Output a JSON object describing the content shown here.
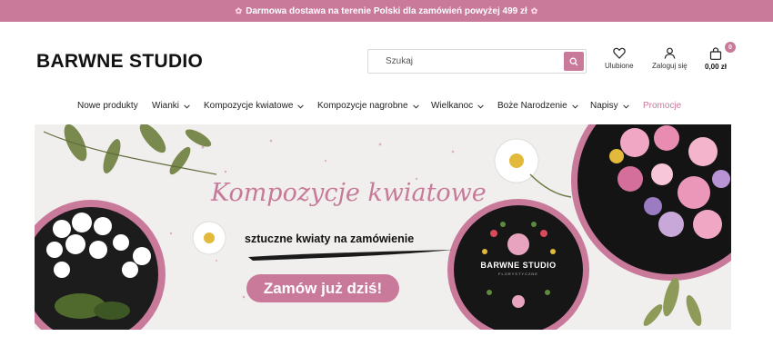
{
  "colors": {
    "accent": "#c9799a"
  },
  "promo": {
    "text": "Darmowa dostawa na terenie Polski dla zamówień powyżej 499 zł",
    "icon": "flower-icon"
  },
  "header": {
    "logo": "BARWNE STUDIO",
    "search": {
      "placeholder": "Szukaj",
      "icon": "search-icon"
    },
    "favorites": {
      "label": "Ulubione",
      "icon": "heart-icon"
    },
    "login": {
      "label": "Zaloguj się",
      "icon": "user-icon"
    },
    "cart": {
      "count": "0",
      "total": "0,00 zł",
      "icon": "bag-icon"
    }
  },
  "nav": {
    "items": [
      {
        "label": "Nowe produkty",
        "dropdown": false
      },
      {
        "label": "Wianki",
        "dropdown": true
      },
      {
        "label": "Kompozycje kwiatowe",
        "dropdown": true
      },
      {
        "label": "Kompozycje nagrobne",
        "dropdown": true
      },
      {
        "label": "Wielkanoc",
        "dropdown": true
      },
      {
        "label": "Boże Narodzenie",
        "dropdown": true
      },
      {
        "label": "Napisy",
        "dropdown": true
      },
      {
        "label": "Promocje",
        "dropdown": false
      }
    ]
  },
  "banner": {
    "title": "Kompozycje kwiatowe",
    "subtitle": "sztuczne kwiaty na zamówienie",
    "cta": "Zamów już dziś!",
    "badge_title": "BARWNE STUDIO",
    "badge_subtitle": "FLORYSTYCZNE"
  }
}
